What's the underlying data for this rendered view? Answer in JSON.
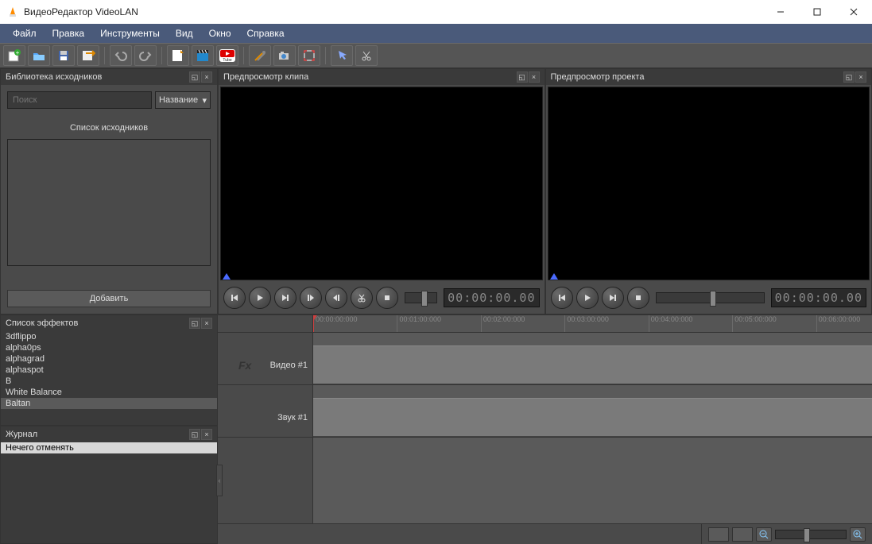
{
  "window": {
    "title": "ВидеоРедактор VideoLAN"
  },
  "menu": [
    "Файл",
    "Правка",
    "Инструменты",
    "Вид",
    "Окно",
    "Справка"
  ],
  "panels": {
    "library": {
      "title": "Библиотека исходников",
      "search_placeholder": "Поиск",
      "sort_label": "Название",
      "list_label": "Список исходников",
      "add_label": "Добавить"
    },
    "clip_preview": {
      "title": "Предпросмотр клипа",
      "timecode": "00:00:00.00"
    },
    "project_preview": {
      "title": "Предпросмотр проекта",
      "timecode": "00:00:00.00"
    },
    "effects": {
      "title": "Список эффектов",
      "items": [
        "3dflippo",
        "alpha0ps",
        "alphagrad",
        "alphaspot",
        "B",
        "White Balance",
        "Baltan"
      ],
      "selected_index": 6
    },
    "journal": {
      "title": "Журнал",
      "items": [
        "Нечего отменять"
      ]
    }
  },
  "timeline": {
    "ticks": [
      "00:00:00:000",
      "00:01:00:000",
      "00:02:00:000",
      "00:03:00:000",
      "00:04:00:000",
      "00:05:00:000",
      "00:06:00:000"
    ],
    "fx_label": "Fx",
    "tracks": [
      {
        "label": "Видео #1",
        "type": "video"
      },
      {
        "label": "Звук #1",
        "type": "audio"
      }
    ]
  }
}
